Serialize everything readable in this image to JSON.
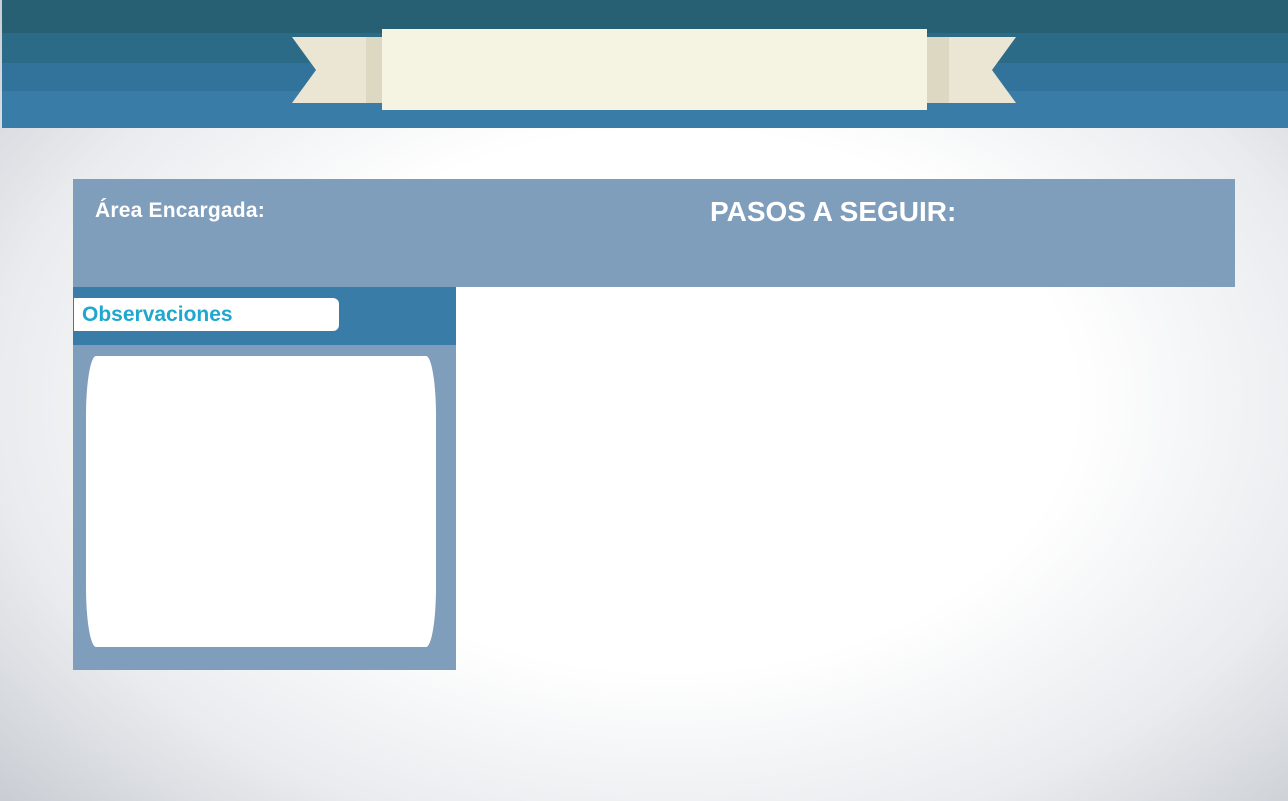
{
  "header": {
    "banner_text": ""
  },
  "info_bar": {
    "area_label": "Área Encargada:",
    "steps_title": "PASOS A SEGUIR:"
  },
  "observations": {
    "tab_label": "Observaciones",
    "value": ""
  },
  "colors": {
    "stripe_dark": "#275f73",
    "stripe_mid": "#2b6b88",
    "stripe_light": "#3a7ca8",
    "info_bar": "#7f9ebc",
    "ribbon_cream": "#f5f4e2",
    "ribbon_fold": "#ebe6d3",
    "accent_text": "#1fa7cf"
  }
}
